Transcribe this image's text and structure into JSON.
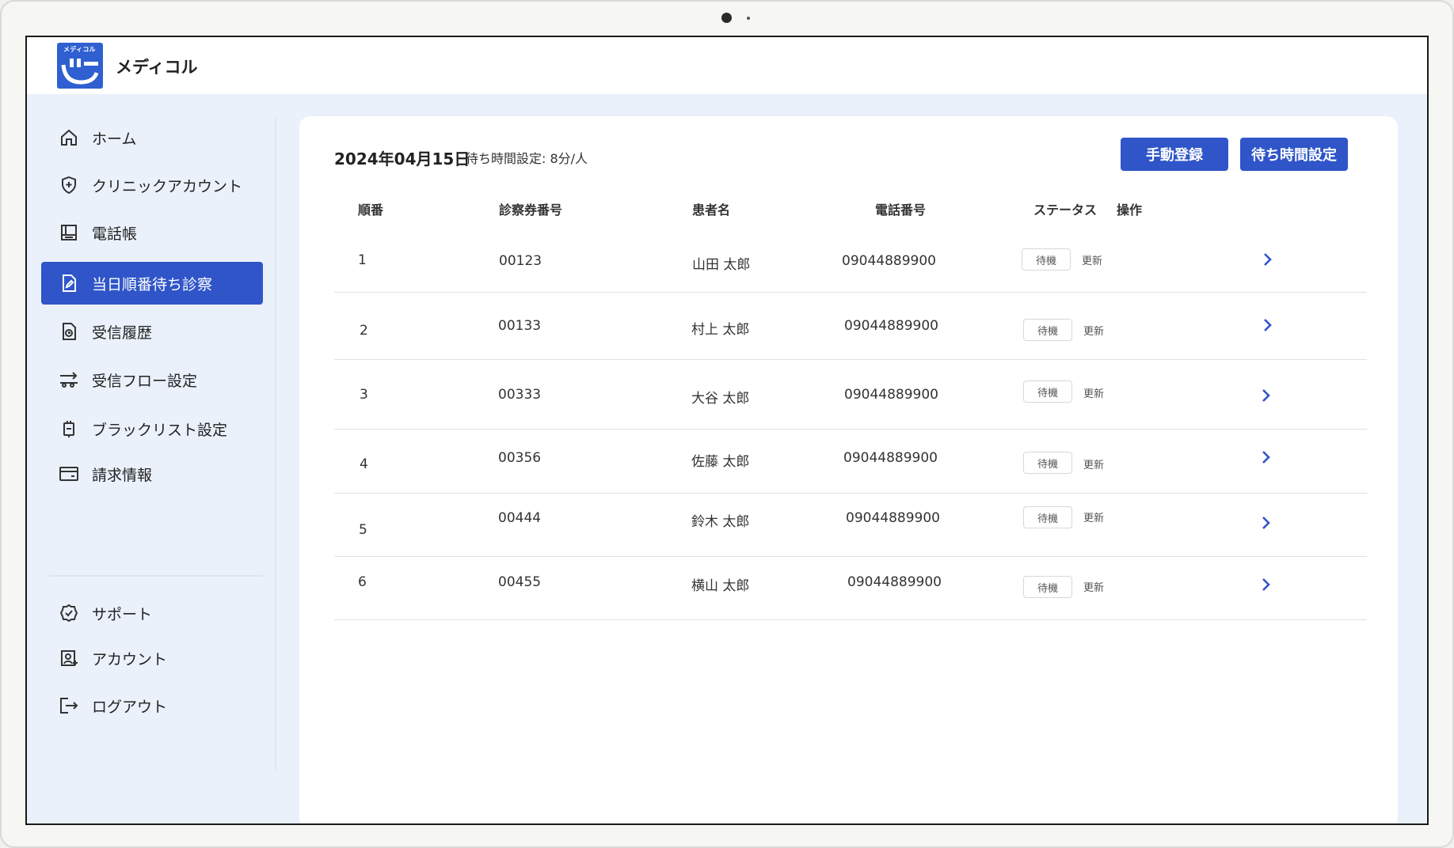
{
  "app": {
    "logo_small_text": "メディコル",
    "name": "メディコル"
  },
  "sidebar": {
    "items": [
      {
        "label": "ホーム",
        "icon": "home-icon"
      },
      {
        "label": "クリニックアカウント",
        "icon": "shield-plus-icon"
      },
      {
        "label": "電話帳",
        "icon": "phonebook-icon"
      },
      {
        "label": "当日順番待ち診察",
        "icon": "document-edit-icon",
        "active": true
      },
      {
        "label": "受信履歴",
        "icon": "history-icon"
      },
      {
        "label": "受信フロー設定",
        "icon": "flow-settings-icon"
      },
      {
        "label": "ブラックリスト設定",
        "icon": "blacklist-icon"
      },
      {
        "label": "請求情報",
        "icon": "billing-icon"
      }
    ],
    "bottom_items": [
      {
        "label": "サポート",
        "icon": "support-check-icon"
      },
      {
        "label": "アカウント",
        "icon": "account-icon"
      },
      {
        "label": "ログアウト",
        "icon": "logout-icon"
      }
    ]
  },
  "main": {
    "date": "2024年04月15日",
    "wait_setting": "待ち時間設定: 8分/人",
    "buttons": {
      "manual_register": "手動登録",
      "wait_time_setting": "待ち時間設定"
    },
    "columns": [
      "順番",
      "診察券番号",
      "患者名",
      "電話番号",
      "ステータス",
      "操作"
    ],
    "rows": [
      {
        "order": "1",
        "card_no": "00123",
        "name": "山田 太郎",
        "phone": "09044889900",
        "status": "待機",
        "action": "更新"
      },
      {
        "order": "2",
        "card_no": "00133",
        "name": "村上 太郎",
        "phone": "09044889900",
        "status": "待機",
        "action": "更新"
      },
      {
        "order": "3",
        "card_no": "00333",
        "name": "大谷 太郎",
        "phone": "09044889900",
        "status": "待機",
        "action": "更新"
      },
      {
        "order": "4",
        "card_no": "00356",
        "name": "佐藤 太郎",
        "phone": "09044889900",
        "status": "待機",
        "action": "更新"
      },
      {
        "order": "5",
        "card_no": "00444",
        "name": "鈴木 太郎",
        "phone": "09044889900",
        "status": "待機",
        "action": "更新"
      },
      {
        "order": "6",
        "card_no": "00455",
        "name": "横山 太郎",
        "phone": "09044889900",
        "status": "待機",
        "action": "更新"
      }
    ]
  },
  "colors": {
    "accent": "#2f55c9",
    "background": "#eaf1fb",
    "card": "#ffffff"
  }
}
